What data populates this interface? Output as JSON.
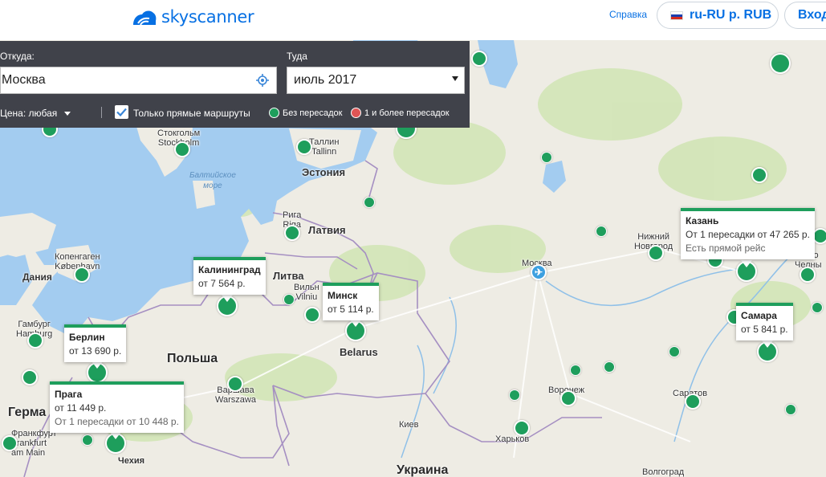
{
  "header": {
    "logo_text": "skyscanner",
    "help_link": "Справка",
    "locale_button": "ru-RU р. RUB",
    "login_button": "Вход"
  },
  "search": {
    "origin_label": "Откуда:",
    "origin_value": "Москва",
    "destination_label": "Туда",
    "date_value": "июль 2017",
    "price_filter": "Цена: любая",
    "direct_only_label": "Только прямые маршруты",
    "direct_only_checked": true,
    "legend_direct": "Без пересадок",
    "legend_stops": "1 и более пересадок",
    "colors": {
      "direct": "#1e9e5c",
      "stops": "#e05555",
      "panel": "#40424a"
    }
  },
  "map": {
    "cities": {
      "stockholm": "Стокгольм\nStockholm",
      "tallinn": "Таллин\nTallinn",
      "riga": "Рига\nRiga",
      "copenhagen": "Копенгаген\nKøbenhavn",
      "vilnius": "Вильн\nVilniu",
      "minsk_small": "Минск",
      "hamburg": "Гамбург\nHamburg",
      "warsaw": "Варшава\nWarszawa",
      "frankfurt": "Франкфурт\nFrankfurt\nam Main",
      "kiev": "Киев",
      "kharkov": "Харьков",
      "voronezh": "Воронеж",
      "saratov": "Саратов",
      "moscow": "Москва",
      "nizhny": "Нижний\nНовгород",
      "cheb": "Чебо\nЧелны",
      "volgograd": "Волгоград"
    },
    "countries": {
      "estonia": "Эстония",
      "latvia": "Латвия",
      "lithuania": "Литва",
      "belarus": "Belarus",
      "denmark": "Дания",
      "czech": "Чехия"
    },
    "big_labels": {
      "poland": "Польша",
      "germany": "Герма",
      "ukraine": "Украина"
    },
    "sea": "Балтийское\nморе",
    "popups": {
      "kaliningrad": {
        "city": "Калининград",
        "price": "от 7 564 р."
      },
      "minsk": {
        "city": "Минск",
        "price": "от 5 114 р."
      },
      "berlin": {
        "city": "Берлин",
        "price": "от 13 690 р."
      },
      "prague": {
        "city": "Прага",
        "price": "от 11 449 р.",
        "note": "От 1 пересадки от 10 448 р."
      },
      "kazan": {
        "city": "Казань",
        "price": "От 1 пересадки от 47 265 р.",
        "note": "Есть прямой рейс"
      },
      "samara": {
        "city": "Самара",
        "price": "от 5 841 р."
      }
    },
    "colors": {
      "water": "#a3ccf0",
      "land": "#eeece4",
      "forest": "#cfe3b0",
      "border": "#9d8ab8"
    }
  }
}
